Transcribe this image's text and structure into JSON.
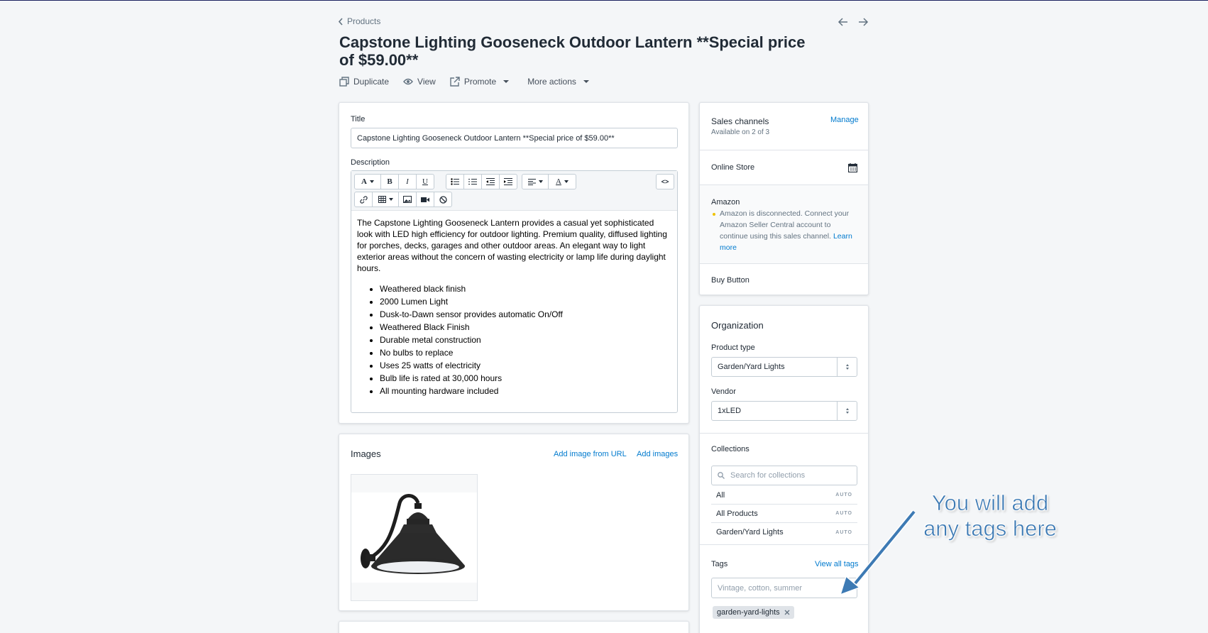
{
  "breadcrumb": {
    "label": "Products"
  },
  "product": {
    "title": "Capstone Lighting Gooseneck Outdoor Lantern **Special price of $59.00**"
  },
  "actions": {
    "duplicate": "Duplicate",
    "view": "View",
    "promote": "Promote",
    "more": "More actions"
  },
  "main": {
    "title_label": "Title",
    "title_value": "Capstone Lighting Gooseneck Outdoor Lantern  **Special price of $59.00**",
    "description_label": "Description",
    "toolbar": {
      "font": "A",
      "bold": "B",
      "italic": "I",
      "underline": "U",
      "color": "A",
      "html": "<>"
    },
    "description_paragraph": "The Capstone Lighting Gooseneck Lantern provides a casual yet sophisticated look with LED high efficiency for outdoor lighting.  Premium quality, diffused lighting for porches, decks, garages and other outdoor areas.  An elegant way to light exterior areas without the concern of wasting electricity or lamp life during daylight hours.",
    "bullets": [
      "Weathered black finish",
      "2000 Lumen Light",
      "Dusk-to-Dawn sensor provides automatic On/Off",
      "Weathered Black Finish",
      "Durable metal construction",
      "No bulbs to replace",
      "Uses 25 watts of electricity",
      "Bulb life is rated at 30,000 hours",
      "All mounting hardware included"
    ]
  },
  "images": {
    "heading": "Images",
    "add_from_url": "Add image from URL",
    "add_images": "Add images"
  },
  "sales_channels": {
    "heading": "Sales channels",
    "manage": "Manage",
    "availability": "Available on 2 of 3",
    "online_store": "Online Store",
    "amazon": "Amazon",
    "amazon_notice": "Amazon is disconnected. Connect your Amazon Seller Central account to continue using this sales channel.",
    "learn_more": "Learn more",
    "buy_button": "Buy Button"
  },
  "organization": {
    "heading": "Organization",
    "product_type_label": "Product type",
    "product_type_value": "Garden/Yard Lights",
    "vendor_label": "Vendor",
    "vendor_value": "1xLED",
    "collections_label": "Collections",
    "collections_search_placeholder": "Search for collections",
    "collections": [
      {
        "name": "All",
        "badge": "AUTO"
      },
      {
        "name": "All Products",
        "badge": "AUTO"
      },
      {
        "name": "Garden/Yard Lights",
        "badge": "AUTO"
      }
    ],
    "tags_label": "Tags",
    "view_all_tags": "View all tags",
    "tags_placeholder": "Vintage, cotton, summer",
    "tags": [
      "garden-yard-lights"
    ]
  },
  "annotation": {
    "line1": "You will add",
    "line2": "any tags here"
  },
  "colors": {
    "accent": "#007ace",
    "annotation": "#3d7ab4",
    "warning_dot": "#eec200"
  }
}
